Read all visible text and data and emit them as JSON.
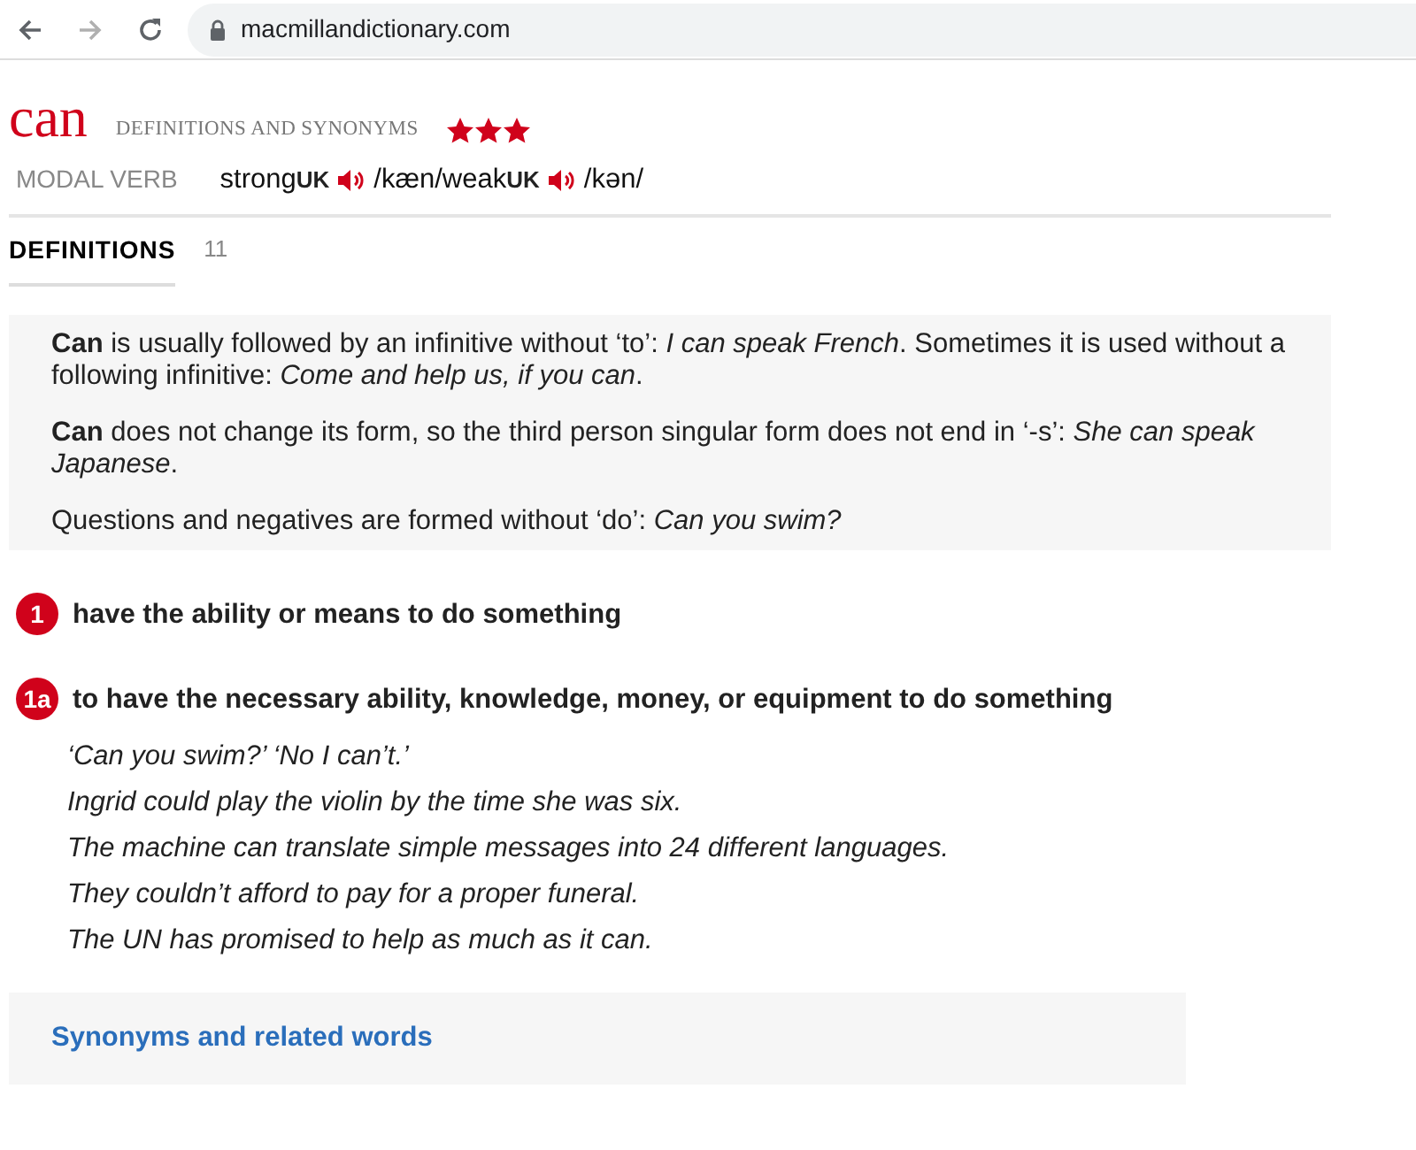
{
  "browser": {
    "address": "macmillandictionary.com",
    "nav_buttons": [
      {
        "kind": "back",
        "disabled": false
      },
      {
        "kind": "forward",
        "disabled": true
      },
      {
        "kind": "reload",
        "disabled": false
      }
    ]
  },
  "entry": {
    "headword": "can",
    "subtitle": "DEFINITIONS AND SYNONYMS",
    "stars": 3,
    "part_of_speech": "MODAL VERB",
    "pronunciations": [
      {
        "label": "strong",
        "region": "UK",
        "ipa": "/kæn/"
      },
      {
        "label": "weak",
        "region": "UK",
        "ipa": "/kən/"
      }
    ]
  },
  "tabs": [
    {
      "label": "DEFINITIONS",
      "count": "11",
      "selected": true
    }
  ],
  "notes": [
    "**Can** is usually followed by an infinitive without ‘to’: *I can speak French*. Sometimes it is used without a following infinitive: *Come and help us, if you can*.",
    "**Can** does not change its form, so the third person singular form does not end in ‘-s’: *She can speak Japanese*.",
    "Questions and negatives are formed without ‘do’: *Can you swim?*"
  ],
  "senses": [
    {
      "number": "1",
      "definition": "have the ability or means to do something"
    },
    {
      "number": "1a",
      "definition": "to have the necessary ability, knowledge, money, or equipment to do something",
      "examples": [
        "‘Can you swim?’ ‘No I can’t.’",
        "Ingrid could play the violin by the time she was six.",
        "The machine can translate simple messages into 24 different languages.",
        "They couldn’t afford to pay for a proper funeral.",
        "The UN has promised to help as much as it can."
      ]
    }
  ],
  "related_link": "Synonyms and related words"
}
